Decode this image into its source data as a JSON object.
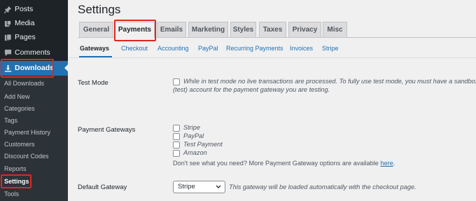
{
  "sidebar": {
    "items": [
      {
        "label": "Posts",
        "icon": "pin-icon"
      },
      {
        "label": "Media",
        "icon": "media-icon"
      },
      {
        "label": "Pages",
        "icon": "pages-icon"
      },
      {
        "label": "Comments",
        "icon": "comments-icon"
      }
    ],
    "current": {
      "label": "Downloads",
      "icon": "download-icon"
    },
    "submenu": [
      "All Downloads",
      "Add New",
      "Categories",
      "Tags",
      "Payment History",
      "Customers",
      "Discount Codes",
      "Reports",
      "Settings",
      "Tools"
    ],
    "submenu_current": "Settings",
    "accent_color": "#2271b1",
    "highlight_color": "#e2261d"
  },
  "main": {
    "title": "Settings",
    "tabs": [
      "General",
      "Payments",
      "Emails",
      "Marketing",
      "Styles",
      "Taxes",
      "Privacy",
      "Misc"
    ],
    "active_tab": "Payments",
    "subnav": [
      "Gateways",
      "Checkout",
      "Accounting",
      "PayPal",
      "Recurring Payments",
      "Invoices",
      "Stripe"
    ],
    "active_subnav": "Gateways",
    "test_mode": {
      "label": "Test Mode",
      "checked": false,
      "description_line1": "While in test mode no live transactions are processed. To fully use test mode, you must have a sandbox",
      "description_line2": "(test) account for the payment gateway you are testing."
    },
    "payment_gateways": {
      "label": "Payment Gateways",
      "options": [
        {
          "label": "Stripe",
          "checked": false
        },
        {
          "label": "PayPal",
          "checked": false
        },
        {
          "label": "Test Payment",
          "checked": false
        },
        {
          "label": "Amazon",
          "checked": false
        }
      ],
      "help_text": "Don't see what you need? More Payment Gateway options are available",
      "help_link": "here",
      "help_suffix": "."
    },
    "default_gateway": {
      "label": "Default Gateway",
      "selected": "Stripe",
      "description": "This gateway will be loaded automatically with the checkout page."
    }
  }
}
